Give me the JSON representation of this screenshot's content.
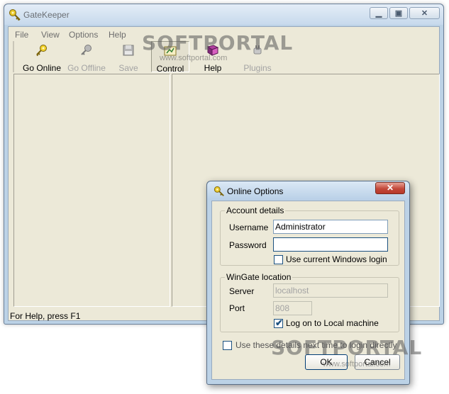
{
  "app": {
    "title": "GateKeeper"
  },
  "menu": {
    "items": [
      "File",
      "View",
      "Options",
      "Help"
    ]
  },
  "toolbar": {
    "buttons": [
      {
        "label": "Go Online",
        "icon": "key-icon",
        "enabled": true
      },
      {
        "label": "Go Offline",
        "icon": "key-gray-icon",
        "enabled": false
      },
      {
        "label": "Save",
        "icon": "save-icon",
        "enabled": false
      },
      {
        "label": "Control",
        "icon": "control-panel-icon",
        "enabled": true,
        "pressed": true
      },
      {
        "label": "Help",
        "icon": "help-book-icon",
        "enabled": true
      },
      {
        "label": "Plugins",
        "icon": "plugins-icon",
        "enabled": false
      }
    ]
  },
  "status": {
    "text": "For Help, press F1"
  },
  "watermark": {
    "brand": "SOFTPORTAL",
    "url": "www.softportal.com"
  },
  "dialog": {
    "title": "Online Options",
    "close_glyph": "✕",
    "account": {
      "legend": "Account details",
      "username_label": "Username",
      "username_value": "Administrator",
      "password_label": "Password",
      "password_value": "",
      "windows_login_label": "Use current Windows login",
      "windows_login_checked": false
    },
    "location": {
      "legend": "WinGate location",
      "server_label": "Server",
      "server_value": "localhost",
      "port_label": "Port",
      "port_value": "808",
      "local_label": "Log on to Local machine",
      "local_checked": true
    },
    "remember_label": "Use these details next time to login directly",
    "remember_checked": false,
    "ok_label": "OK",
    "cancel_label": "Cancel"
  },
  "colors": {
    "dialog_close": "#c3483a",
    "frame": "#bcd2e6",
    "face": "#ece9d8"
  }
}
